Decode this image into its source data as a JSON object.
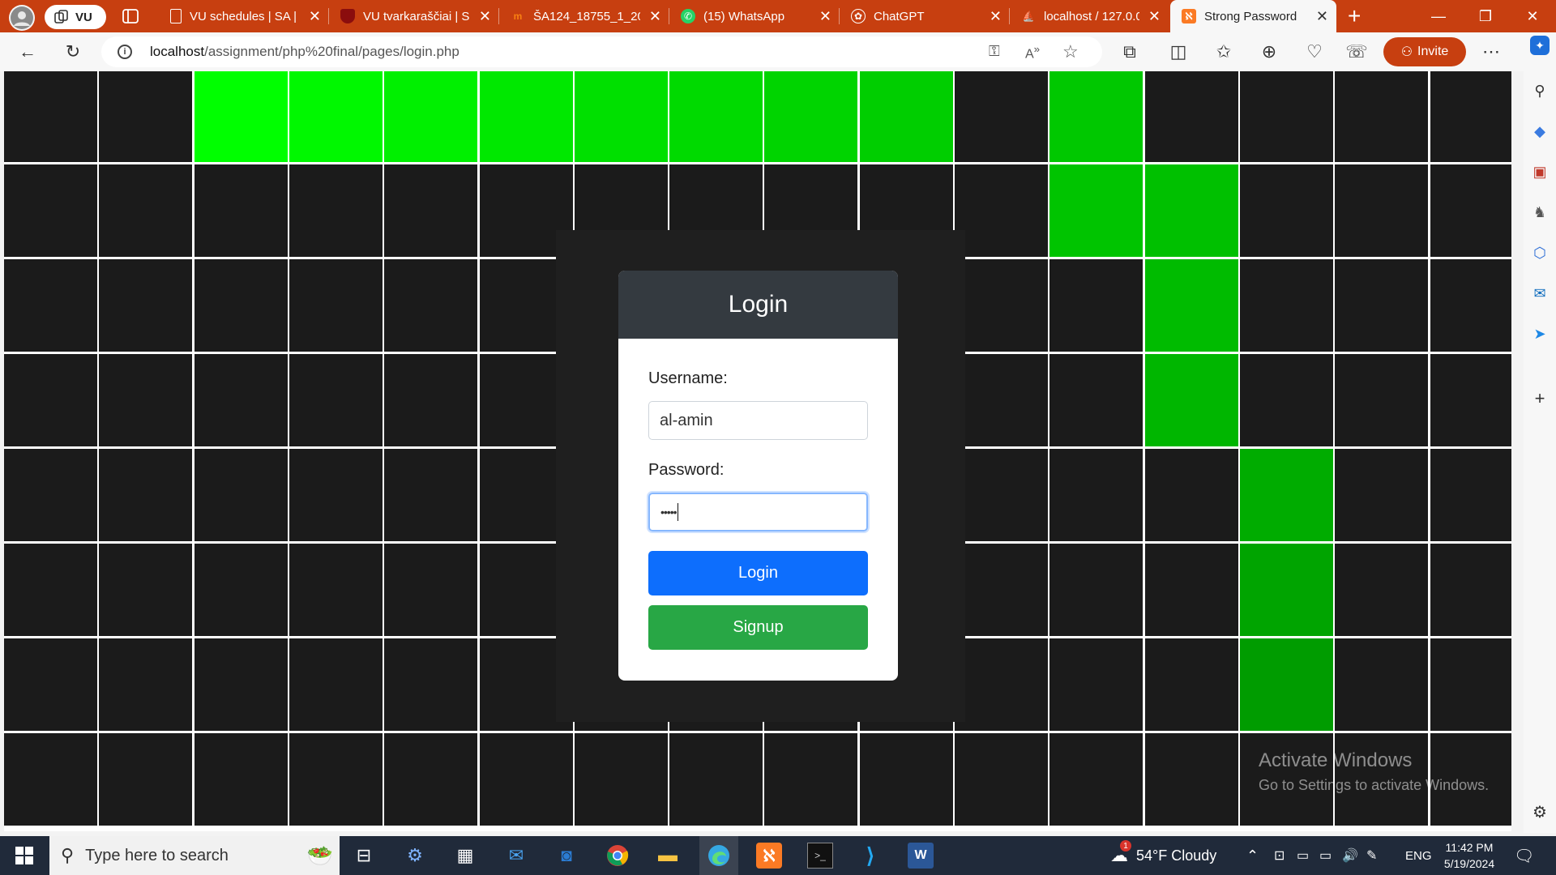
{
  "browser": {
    "profile_pill_label": "VU",
    "tabs": [
      {
        "title": "VU schedules | SA |",
        "icon": "document-icon"
      },
      {
        "title": "VU tvarkaraščiai | S",
        "icon": "shield-icon"
      },
      {
        "title": "ŠA124_18755_1_20",
        "icon": "moodle-icon"
      },
      {
        "title": "(15) WhatsApp",
        "icon": "whatsapp-icon"
      },
      {
        "title": "ChatGPT",
        "icon": "chatgpt-icon"
      },
      {
        "title": "localhost / 127.0.0.",
        "icon": "phpmyadmin-icon"
      },
      {
        "title": "Strong Password",
        "icon": "xampp-icon",
        "active": true
      }
    ],
    "url_domain": "localhost",
    "url_path": "/assignment/php%20final/pages/login.php",
    "invite_label": "Invite",
    "accent": "#c73f10"
  },
  "grid": {
    "cols": 16,
    "rows": 8,
    "dark_color": "#1b1b1b",
    "line_color": "#ffffff",
    "green_cells": [
      {
        "row": 0,
        "col": 2,
        "color": "#00ff00"
      },
      {
        "row": 0,
        "col": 3,
        "color": "#00f800"
      },
      {
        "row": 0,
        "col": 4,
        "color": "#00f000"
      },
      {
        "row": 0,
        "col": 5,
        "color": "#00e800"
      },
      {
        "row": 0,
        "col": 6,
        "color": "#00e000"
      },
      {
        "row": 0,
        "col": 7,
        "color": "#00da00"
      },
      {
        "row": 0,
        "col": 8,
        "color": "#00d400"
      },
      {
        "row": 0,
        "col": 9,
        "color": "#00ce00"
      },
      {
        "row": 0,
        "col": 11,
        "color": "#00c800"
      },
      {
        "row": 1,
        "col": 11,
        "color": "#00c400"
      },
      {
        "row": 1,
        "col": 12,
        "color": "#00c000"
      },
      {
        "row": 2,
        "col": 12,
        "color": "#00bb00"
      },
      {
        "row": 3,
        "col": 12,
        "color": "#00b600"
      },
      {
        "row": 4,
        "col": 13,
        "color": "#00ac00"
      },
      {
        "row": 5,
        "col": 13,
        "color": "#00a400"
      },
      {
        "row": 6,
        "col": 13,
        "color": "#009c00"
      }
    ]
  },
  "login": {
    "title": "Login",
    "username_label": "Username:",
    "username_value": "al-amin",
    "password_label": "Password:",
    "password_value": "•••••",
    "login_button": "Login",
    "signup_button": "Signup",
    "login_color": "#0d6efd",
    "signup_color": "#28a745"
  },
  "watermark": {
    "line1": "Activate Windows",
    "line2": "Go to Settings to activate Windows."
  },
  "taskbar": {
    "search_placeholder": "Type here to search",
    "weather": "54°F  Cloudy",
    "weather_badge": "1",
    "language": "ENG",
    "time": "11:42 PM",
    "date": "5/19/2024"
  }
}
